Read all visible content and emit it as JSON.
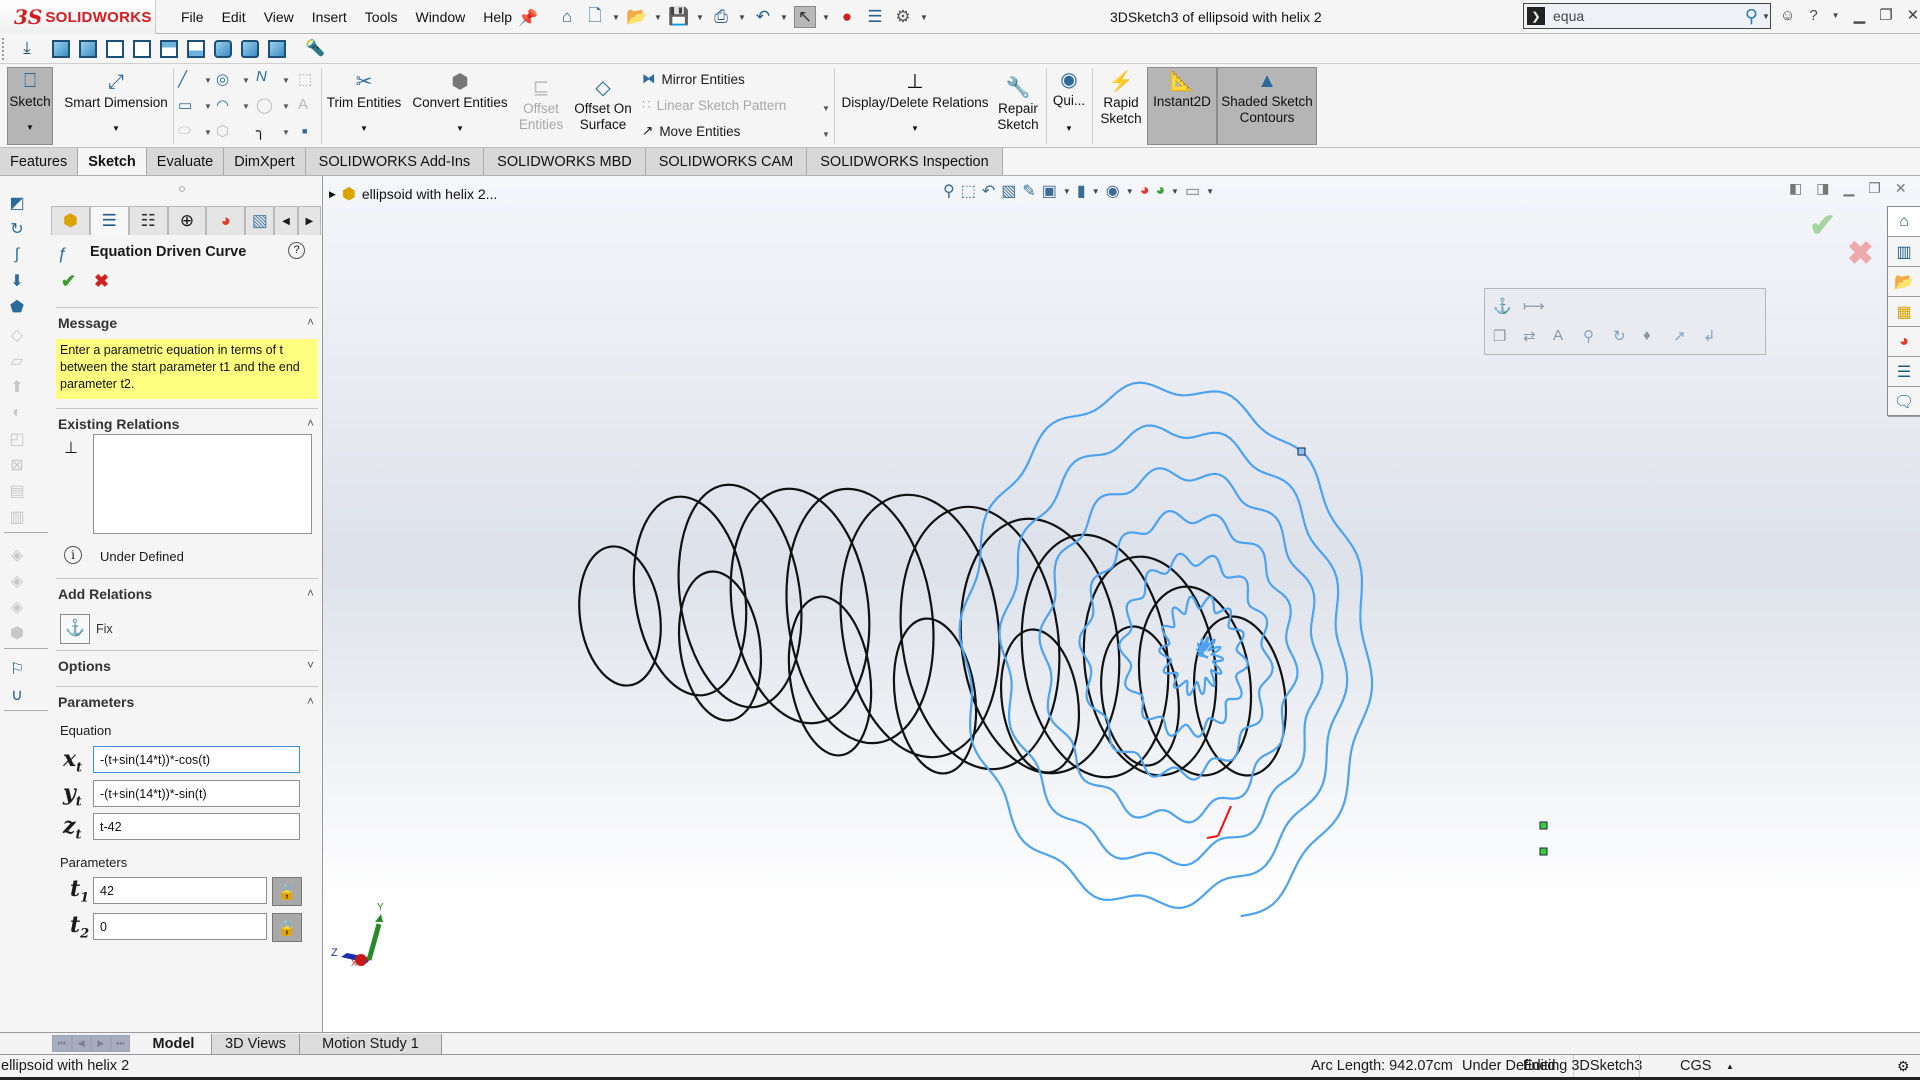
{
  "app": {
    "brand": "SOLIDWORKS",
    "document_title": "3DSketch3 of ellipsoid with helix 2",
    "menu": [
      "File",
      "Edit",
      "View",
      "Insert",
      "Tools",
      "Window",
      "Help"
    ],
    "search": {
      "value": "equa",
      "icon": "search-icon"
    },
    "quick_access_icons": [
      "home-icon",
      "new-document-icon",
      "open-icon",
      "save-icon",
      "print-icon",
      "undo-icon",
      "select-icon",
      "rebuild-icon",
      "file-properties-icon",
      "options-icon"
    ]
  },
  "view_toolbar_icons": [
    "normal-to-icon",
    "front-view-icon",
    "back-view-icon",
    "left-view-icon",
    "right-view-icon",
    "top-view-icon",
    "bottom-view-icon",
    "isometric-icon",
    "trimetric-icon",
    "dimetric-icon",
    "flashlight-icon"
  ],
  "command_manager": {
    "sketch": "Sketch",
    "smart_dimension": "Smart Dimension",
    "trim_entities": "Trim Entities",
    "convert_entities": "Convert Entities",
    "offset_entities_1": "Offset",
    "offset_entities_2": "Entities",
    "offset_on_surface_1": "Offset On",
    "offset_on_surface_2": "Surface",
    "mirror_entities": "Mirror Entities",
    "linear_sketch_pattern": "Linear Sketch Pattern",
    "move_entities": "Move Entities",
    "display_delete_relations": "Display/Delete Relations",
    "repair_sketch_1": "Repair",
    "repair_sketch_2": "Sketch",
    "quick_snaps": "Qui...",
    "rapid_sketch_1": "Rapid",
    "rapid_sketch_2": "Sketch",
    "instant2d": "Instant2D",
    "shaded_contours_1": "Shaded Sketch",
    "shaded_contours_2": "Contours"
  },
  "tabs": [
    {
      "label": "Features",
      "active": false
    },
    {
      "label": "Sketch",
      "active": true
    },
    {
      "label": "Evaluate",
      "active": false
    },
    {
      "label": "DimXpert",
      "active": false
    },
    {
      "label": "SOLIDWORKS Add-Ins",
      "active": false
    },
    {
      "label": "SOLIDWORKS MBD",
      "active": false
    },
    {
      "label": "SOLIDWORKS CAM",
      "active": false
    },
    {
      "label": "SOLIDWORKS Inspection",
      "active": false
    }
  ],
  "property_manager": {
    "title": "Equation Driven Curve",
    "message_header": "Message",
    "message": "Enter a parametric equation in terms of t between the start parameter t1 and the end parameter t2.",
    "existing_relations_header": "Existing Relations",
    "status": "Under Defined",
    "add_relations_header": "Add Relations",
    "fix_label": "Fix",
    "options_header": "Options",
    "parameters_header": "Parameters",
    "equation_label": "Equation",
    "x_label": "x",
    "y_label": "y",
    "z_label": "z",
    "t_sub": "t",
    "x_equation": "-(t+sin(14*t))*-cos(t)",
    "y_equation": "-(t+sin(14*t))*-sin(t)",
    "z_equation": "t-42",
    "params_label": "Parameters",
    "t1_label": "t",
    "t1_sub": "1",
    "t1_value": "42",
    "t2_label": "t",
    "t2_sub": "2",
    "t2_value": "0"
  },
  "viewport": {
    "tree_item": "ellipsoid with helix 2...",
    "triad": {
      "x": "X",
      "y": "Y",
      "z": "Z"
    },
    "colors": {
      "curve_preview": "#4da3f0",
      "sketch_lines": "#111111",
      "confirm": "#a5d6a0",
      "cancel": "#eeaaaa"
    }
  },
  "bottom_tabs": [
    {
      "label": "Model",
      "active": true
    },
    {
      "label": "3D Views",
      "active": false
    },
    {
      "label": "Motion Study 1",
      "active": false
    }
  ],
  "status_bar": {
    "left": "ellipsoid with helix 2",
    "arc_length": "Arc Length: 942.07cm",
    "definition": "Under Defined",
    "editing": "Editing 3DSketch3",
    "units": "CGS"
  }
}
